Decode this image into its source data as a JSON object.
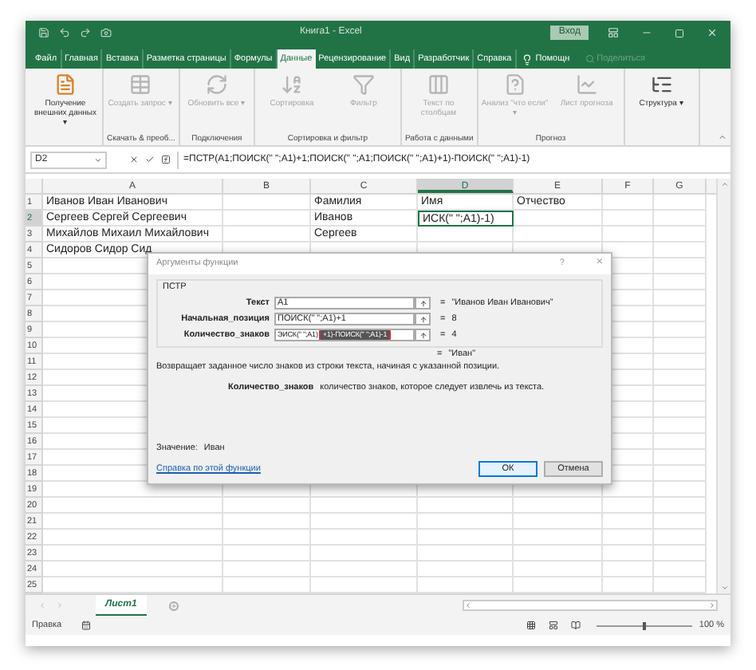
{
  "window": {
    "title": "Книга1 - Excel",
    "signin": "Вход"
  },
  "tabs": [
    {
      "label": "Файл",
      "selected": false
    },
    {
      "label": "Главная",
      "selected": false
    },
    {
      "label": "Вставка",
      "selected": false
    },
    {
      "label": "Разметка страницы",
      "selected": false
    },
    {
      "label": "Формулы",
      "selected": false
    },
    {
      "label": "Данные",
      "selected": true
    },
    {
      "label": "Рецензирование",
      "selected": false
    },
    {
      "label": "Вид",
      "selected": false
    },
    {
      "label": "Разработчик",
      "selected": false
    },
    {
      "label": "Справка",
      "selected": false
    }
  ],
  "tell_me": "Помощн",
  "share": "Поделиться",
  "ribbon": [
    {
      "buttons": [
        {
          "label": "Получение внешних данных ▾",
          "disabled": false,
          "kind": "file"
        }
      ]
    },
    {
      "label": "Скачать & преоб...",
      "buttons": [
        {
          "label": "Создать запрос ▾",
          "disabled": true,
          "kind": "table"
        }
      ]
    },
    {
      "label": "Подключения",
      "buttons": [
        {
          "label": "Обновить все ▾",
          "disabled": true,
          "kind": "refresh"
        }
      ]
    },
    {
      "label": "Сортировка и фильтр",
      "buttons": [
        {
          "label": "Сортировка",
          "disabled": true,
          "kind": "sort"
        },
        {
          "label": "Фильтр",
          "disabled": true,
          "kind": "filter"
        }
      ]
    },
    {
      "label": "Работа с данными",
      "buttons": [
        {
          "label": "Текст по столбцам",
          "disabled": true,
          "kind": "columns"
        }
      ]
    },
    {
      "label": "Прогноз",
      "buttons": [
        {
          "label": "Анализ \"что если\" ▾",
          "disabled": true,
          "kind": "whatif"
        },
        {
          "label": "Лист прогноза",
          "disabled": true,
          "kind": "chart"
        }
      ]
    },
    {
      "buttons": [
        {
          "label": "Структура ▾",
          "disabled": false,
          "kind": "outline"
        }
      ]
    }
  ],
  "formula_bar": {
    "name_box": "D2",
    "formula": "=ПСТР(A1;ПОИСК(\" \";A1)+1;ПОИСК(\" \";A1;ПОИСК(\" \";A1)+1)-ПОИСК(\" \";A1)-1)"
  },
  "grid": {
    "columns": [
      {
        "label": "A",
        "selected": false
      },
      {
        "label": "B",
        "selected": false
      },
      {
        "label": "C",
        "selected": false
      },
      {
        "label": "D",
        "selected": true
      },
      {
        "label": "E",
        "selected": false
      },
      {
        "label": "F",
        "selected": false
      },
      {
        "label": "G",
        "selected": false
      }
    ],
    "rows": [
      {
        "number": "1",
        "selected": false,
        "cells": [
          {
            "text": "Иванов Иван Иванович",
            "selected": false
          },
          null,
          {
            "text": "Фамилия",
            "selected": false
          },
          {
            "text": "Имя",
            "selected": false
          },
          {
            "text": "Отчество",
            "selected": false
          },
          null,
          null
        ]
      },
      {
        "number": "2",
        "selected": true,
        "cells": [
          {
            "text": "Сергеев Сергей Сергеевич",
            "selected": false
          },
          null,
          {
            "text": "Иванов",
            "selected": false
          },
          {
            "text": "ИСК(\" \";A1)-1)",
            "selected": true
          },
          null,
          null,
          null
        ]
      },
      {
        "number": "3",
        "selected": false,
        "cells": [
          {
            "text": "Михайлов Михаил Михайлович",
            "selected": false
          },
          null,
          {
            "text": "Сергеев",
            "selected": false
          },
          null,
          null,
          null,
          null
        ]
      },
      {
        "number": "4",
        "selected": false,
        "cells": [
          {
            "text": "Сидоров Сидор Сид",
            "selected": false
          },
          null,
          null,
          null,
          null,
          null,
          null
        ]
      },
      {
        "number": "5",
        "selected": false
      },
      {
        "number": "6",
        "selected": false
      },
      {
        "number": "7",
        "selected": false
      },
      {
        "number": "8",
        "selected": false
      },
      {
        "number": "9",
        "selected": false
      },
      {
        "number": "10",
        "selected": false
      },
      {
        "number": "11",
        "selected": false
      },
      {
        "number": "12",
        "selected": false
      },
      {
        "number": "13",
        "selected": false
      },
      {
        "number": "14",
        "selected": false
      },
      {
        "number": "15",
        "selected": false
      },
      {
        "number": "16",
        "selected": false
      },
      {
        "number": "17",
        "selected": false
      },
      {
        "number": "18",
        "selected": false
      },
      {
        "number": "19",
        "selected": false
      },
      {
        "number": "20",
        "selected": false
      },
      {
        "number": "21",
        "selected": false
      },
      {
        "number": "22",
        "selected": false
      },
      {
        "number": "23",
        "selected": false
      },
      {
        "number": "24",
        "selected": false
      },
      {
        "number": "25",
        "selected": false
      }
    ]
  },
  "dialog": {
    "title": "Аргументы функции",
    "help": "?",
    "close": "×",
    "function": "ПСТР",
    "arguments": [
      {
        "name": "Текст",
        "value": "A1",
        "equals": "=",
        "result": "\"Иванов Иван Иванович\""
      },
      {
        "name": "Начальная_позиция",
        "value": "ПОИСК(\" \";A1)+1",
        "equals": "=",
        "result": "8"
      },
      {
        "name": "Количество_знаков",
        "value": "ЭИСК(\" \";A1)",
        "highlighted_value": "+1)-ПОИСК(\" \";A1)-1",
        "equals": "=",
        "result": "4"
      }
    ],
    "total_equals": "=",
    "total": "\"Иван\"",
    "description": "Возвращает заданное число знаков из строки текста, начиная с указанной позиции.",
    "arg_name": "Количество_знаков",
    "arg_help": "количество знаков, которое следует извлечь из текста.",
    "value_label": "Значение:",
    "value": "Иван",
    "help_link": "Справка по этой функции",
    "ok": "ОК",
    "cancel": "Отмена"
  },
  "sheets": [
    {
      "label": "Лист1",
      "selected": true
    }
  ],
  "status_bar": {
    "mode": "Правка",
    "zoom": "100 %",
    "zoom_slider": {
      "level": 0.5
    }
  }
}
